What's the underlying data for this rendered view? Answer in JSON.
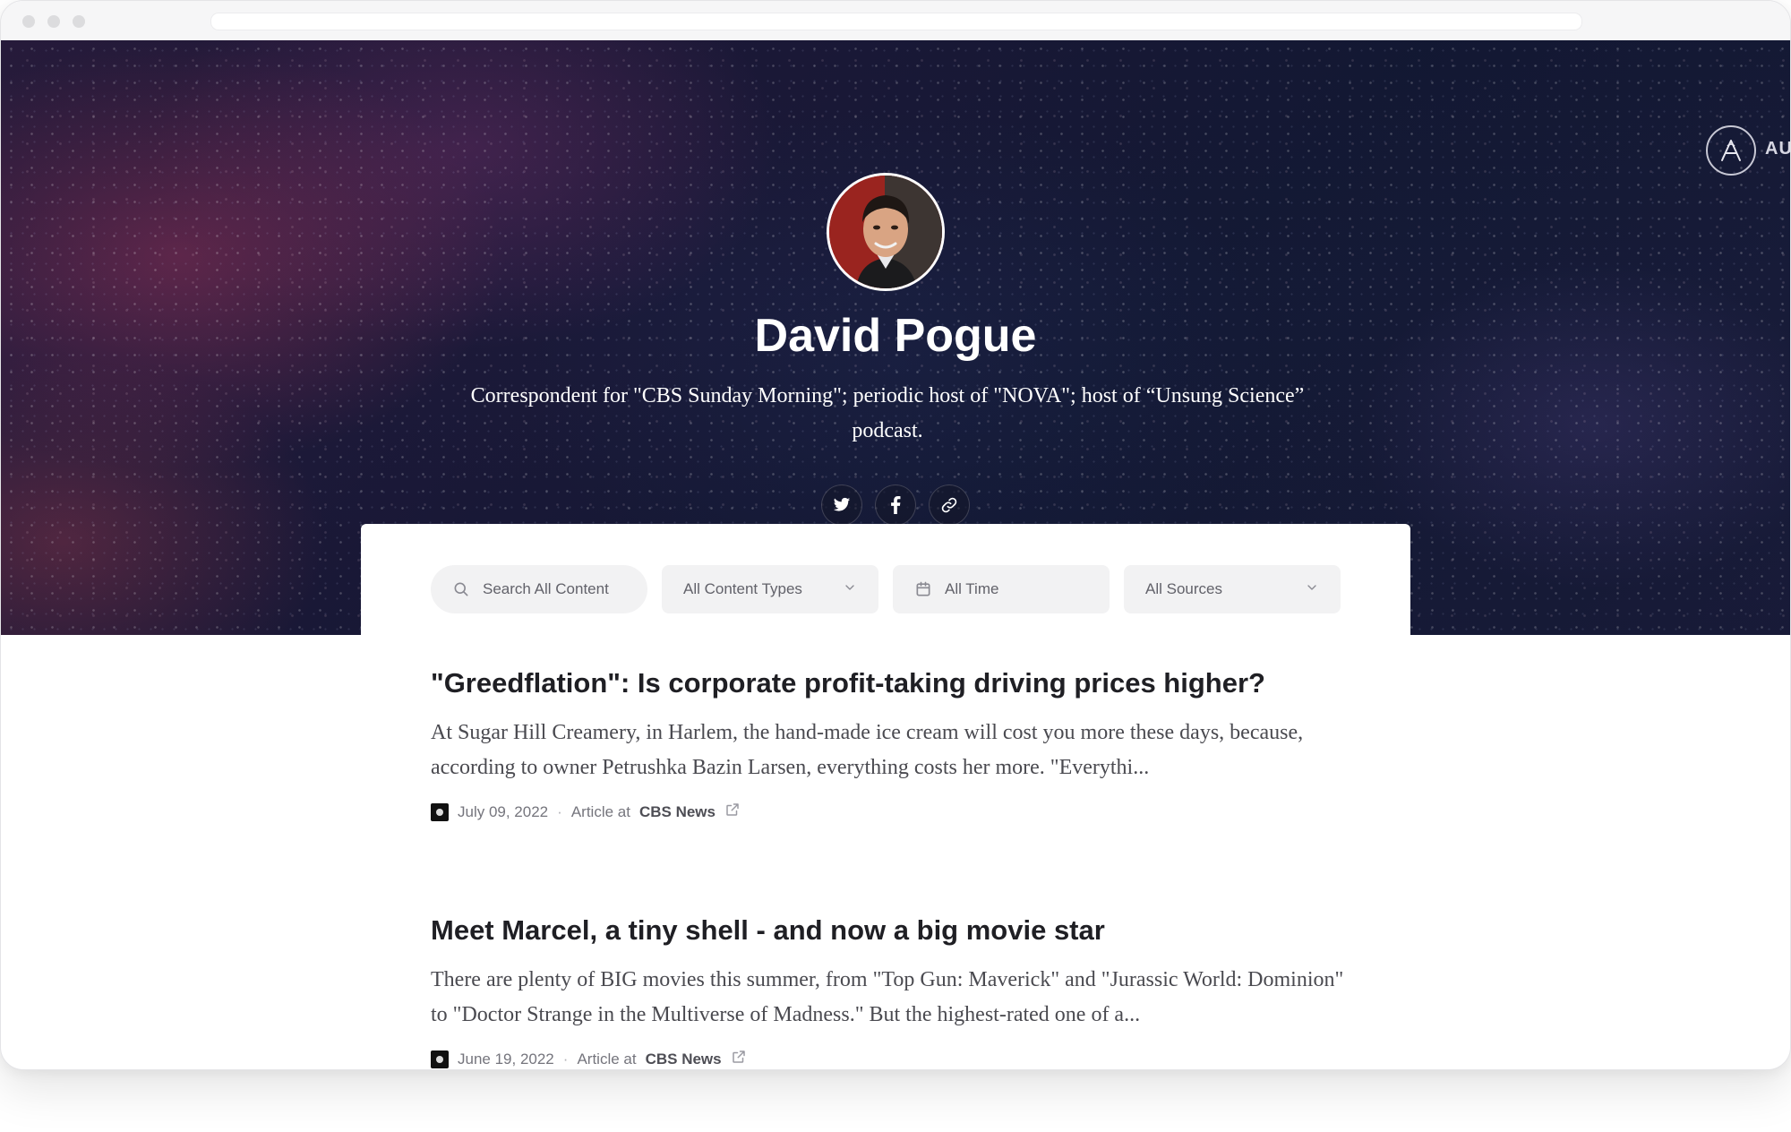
{
  "profile": {
    "name": "David Pogue",
    "bio": "Correspondent for \"CBS Sunday Morning\"; periodic host of \"NOVA\"; host of “Unsung Science” podcast."
  },
  "brand": {
    "corner_text": "AU"
  },
  "socials": [
    {
      "icon": "twitter-icon"
    },
    {
      "icon": "facebook-icon"
    },
    {
      "icon": "link-icon"
    }
  ],
  "filters": {
    "search_placeholder": "Search All Content",
    "content_type": "All Content Types",
    "time": "All Time",
    "sources": "All Sources"
  },
  "articles": [
    {
      "title": "\"Greedflation\": Is corporate profit-taking driving prices higher?",
      "excerpt": "At Sugar Hill Creamery, in Harlem, the hand-made ice cream will cost you more these days, because, according to owner Petrushka Bazin Larsen, everything costs her more. \"Everythi...",
      "date": "July 09, 2022",
      "type_prefix": "Article at",
      "source": "CBS News"
    },
    {
      "title": "Meet Marcel, a tiny shell - and now a big movie star",
      "excerpt": "There are plenty of BIG movies this summer, from \"Top Gun: Maverick\" and \"Jurassic World: Dominion\" to \"Doctor Strange in the Multiverse of Madness.\" But the highest-rated one of a...",
      "date": "June 19, 2022",
      "type_prefix": "Article at",
      "source": "CBS News"
    }
  ],
  "colors": {
    "hero_dark": "#1c1a3a",
    "panel_bg": "#ffffff",
    "filter_bg": "#f2f2f3",
    "title_text": "#1f1f24"
  }
}
